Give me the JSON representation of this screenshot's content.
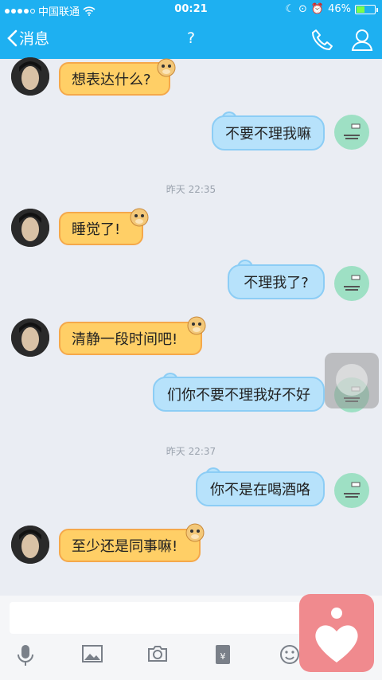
{
  "status": {
    "carrier": "中国联通",
    "time": "00:21",
    "battery": "46%",
    "battery_level": 0.46
  },
  "nav": {
    "back_label": "消息",
    "title": "?"
  },
  "timestamps": [
    "昨天 22:35",
    "昨天 22:37"
  ],
  "messages": [
    {
      "side": "left",
      "text": "想表达什么?"
    },
    {
      "side": "right",
      "text": "不要不理我嘛"
    },
    {
      "side": "left",
      "text": "睡觉了!"
    },
    {
      "side": "right",
      "text": "不理我了?"
    },
    {
      "side": "left",
      "text": "清静一段时间吧!"
    },
    {
      "side": "right",
      "text": "们你不要不理我好不好"
    },
    {
      "side": "right",
      "text": "你不是在喝酒咯"
    },
    {
      "side": "left",
      "text": "至少还是同事嘛!"
    }
  ],
  "icons": {
    "back": "chevron-left-icon",
    "phone": "phone-icon",
    "profile": "user-icon",
    "toolbar": [
      "microphone-icon",
      "image-icon",
      "camera-icon",
      "red-envelope-icon",
      "emoji-icon"
    ],
    "floating": "heart-icon"
  },
  "colors": {
    "nav": "#1eb0f1",
    "bubble_left": "#ffcf66",
    "bubble_right": "#b7e2fb",
    "background": "#eaedf3"
  }
}
